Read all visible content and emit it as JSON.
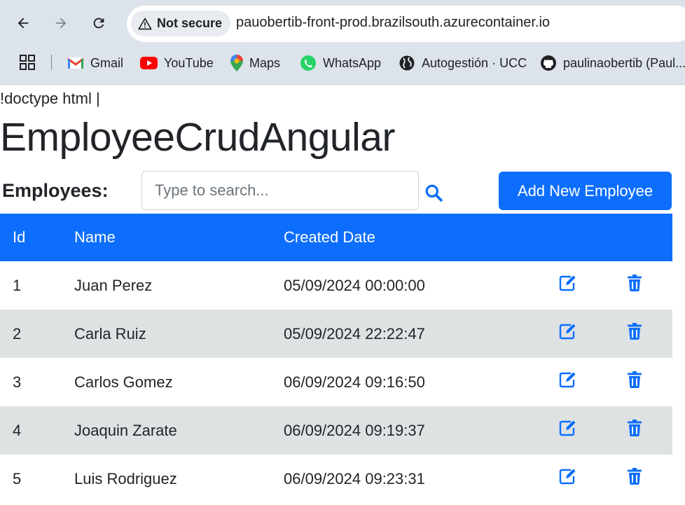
{
  "browser": {
    "security_label": "Not secure",
    "url": "pauobertib-front-prod.brazilsouth.azurecontainer.io",
    "bookmarks": [
      {
        "label": "Gmail",
        "icon": "gmail-icon"
      },
      {
        "label": "YouTube",
        "icon": "youtube-icon"
      },
      {
        "label": "Maps",
        "icon": "maps-icon"
      },
      {
        "label": "WhatsApp",
        "icon": "whatsapp-icon"
      },
      {
        "label": "Autogestión · UCC",
        "icon": "globe-icon"
      },
      {
        "label": "paulinaobertib (Paul...",
        "icon": "github-icon"
      }
    ]
  },
  "page": {
    "doctype_text": "!doctype html |",
    "title": "EmployeeCrudAngular",
    "employees_label": "Employees:",
    "search_placeholder": "Type to search...",
    "add_button_label": "Add New Employee"
  },
  "table": {
    "columns": [
      "Id",
      "Name",
      "Created Date",
      "",
      ""
    ],
    "rows": [
      {
        "id": "1",
        "name": "Juan Perez",
        "created": "05/09/2024 00:00:00"
      },
      {
        "id": "2",
        "name": "Carla Ruiz",
        "created": "05/09/2024 22:22:47"
      },
      {
        "id": "3",
        "name": "Carlos Gomez",
        "created": "06/09/2024 09:16:50"
      },
      {
        "id": "4",
        "name": "Joaquin Zarate",
        "created": "06/09/2024 09:19:37"
      },
      {
        "id": "5",
        "name": "Luis Rodriguez",
        "created": "06/09/2024 09:23:31"
      }
    ]
  },
  "colors": {
    "primary": "#0d6efd",
    "striped_row": "#dee2e3",
    "browser_chrome": "#dde3ea"
  }
}
